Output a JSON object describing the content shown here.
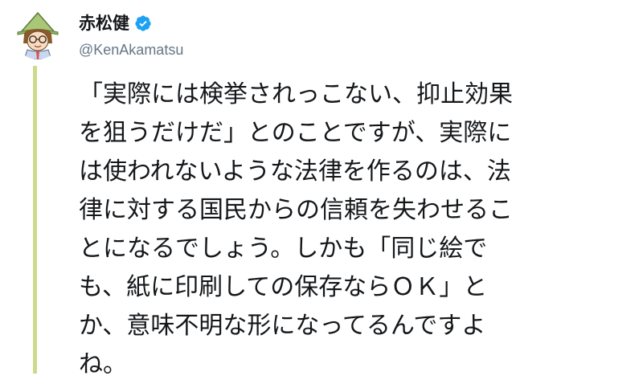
{
  "author": {
    "display_name": "赤松健",
    "handle": "@KenAkamatsu",
    "verified": true,
    "avatar_icon": "wizard-avatar-icon"
  },
  "tweet": {
    "lines": [
      "「実際には検挙されっこない、抑止効果",
      "を狙うだけだ」とのことですが、実際に",
      "は使われないような法律を作るのは、法",
      "律に対する国民からの信頼を失わせるこ",
      "とになるでしょう。しかも「同じ絵で",
      "も、紙に印刷しての保存ならＯＫ」と",
      "か、意味不明な形になってるんですよ",
      "ね。"
    ]
  },
  "colors": {
    "verified_badge": "#1da1f2",
    "thread_line": "#cfd98c",
    "handle_text": "#657786",
    "body_text": "#14171a"
  }
}
